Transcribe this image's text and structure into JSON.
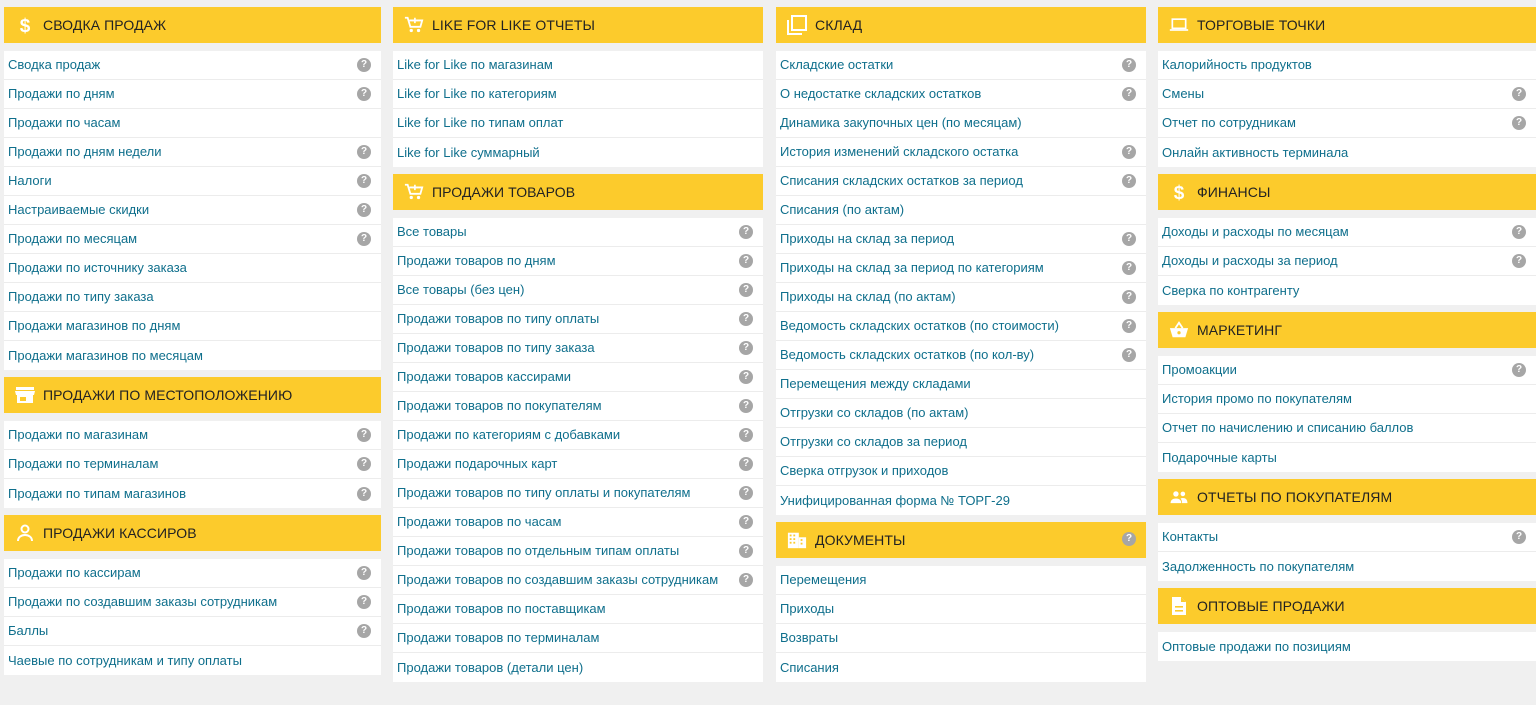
{
  "accent_color": "#fccb2c",
  "link_color": "#0f6f8c",
  "help_glyph": "?",
  "columns": [
    {
      "sections": [
        {
          "icon": "dollar-icon",
          "title": "СВОДКА ПРОДАЖ",
          "items": [
            {
              "label": "Сводка продаж",
              "help": true
            },
            {
              "label": "Продажи по дням",
              "help": true
            },
            {
              "label": "Продажи по часам",
              "help": false
            },
            {
              "label": "Продажи по дням недели",
              "help": true
            },
            {
              "label": "Налоги",
              "help": true
            },
            {
              "label": "Настраиваемые скидки",
              "help": true
            },
            {
              "label": "Продажи по месяцам",
              "help": true
            },
            {
              "label": "Продажи по источнику заказа",
              "help": false
            },
            {
              "label": "Продажи по типу заказа",
              "help": false
            },
            {
              "label": "Продажи магазинов по дням",
              "help": false
            },
            {
              "label": "Продажи магазинов по месяцам",
              "help": false
            }
          ]
        },
        {
          "icon": "store-icon",
          "title": "ПРОДАЖИ ПО МЕСТОПОЛОЖЕНИЮ",
          "items": [
            {
              "label": "Продажи по магазинам",
              "help": true
            },
            {
              "label": "Продажи по терминалам",
              "help": true
            },
            {
              "label": "Продажи по типам магазинов",
              "help": true
            }
          ]
        },
        {
          "icon": "person-icon",
          "title": "ПРОДАЖИ КАССИРОВ",
          "items": [
            {
              "label": "Продажи по кассирам",
              "help": true
            },
            {
              "label": "Продажи по создавшим заказы сотрудникам",
              "help": true
            },
            {
              "label": "Баллы",
              "help": true
            },
            {
              "label": "Чаевые по сотрудникам и типу оплаты",
              "help": false
            }
          ]
        }
      ]
    },
    {
      "sections": [
        {
          "icon": "cart-icon",
          "title": "LIKE FOR LIKE ОТЧЕТЫ",
          "items": [
            {
              "label": "Like for Like по магазинам",
              "help": false
            },
            {
              "label": "Like for Like по категориям",
              "help": false
            },
            {
              "label": "Like for Like по типам оплат",
              "help": false
            },
            {
              "label": "Like for Like суммарный",
              "help": false
            }
          ]
        },
        {
          "icon": "cart-icon",
          "title": "ПРОДАЖИ ТОВАРОВ",
          "items": [
            {
              "label": "Все товары",
              "help": true
            },
            {
              "label": "Продажи товаров по дням",
              "help": true
            },
            {
              "label": "Все товары (без цен)",
              "help": true
            },
            {
              "label": "Продажи товаров по типу оплаты",
              "help": true
            },
            {
              "label": "Продажи товаров по типу заказа",
              "help": true
            },
            {
              "label": "Продажи товаров кассирами",
              "help": true
            },
            {
              "label": "Продажи товаров по покупателям",
              "help": true
            },
            {
              "label": "Продажи по категориям с добавками",
              "help": true
            },
            {
              "label": "Продажи подарочных карт",
              "help": true
            },
            {
              "label": "Продажи товаров по типу оплаты и покупателям",
              "help": true
            },
            {
              "label": "Продажи товаров по часам",
              "help": true
            },
            {
              "label": "Продажи товаров по отдельным типам оплаты",
              "help": true
            },
            {
              "label": "Продажи товаров по создавшим заказы сотрудникам",
              "help": true
            },
            {
              "label": "Продажи товаров по поставщикам",
              "help": false
            },
            {
              "label": "Продажи товаров по терминалам",
              "help": false
            },
            {
              "label": "Продажи товаров (детали цен)",
              "help": false
            }
          ]
        }
      ]
    },
    {
      "sections": [
        {
          "icon": "copy-icon",
          "title": "СКЛАД",
          "items": [
            {
              "label": "Складские остатки",
              "help": true
            },
            {
              "label": "О недостатке складских остатков",
              "help": true
            },
            {
              "label": "Динамика закупочных цен (по месяцам)",
              "help": false
            },
            {
              "label": "История изменений складского остатка",
              "help": true
            },
            {
              "label": "Списания складских остатков за период",
              "help": true
            },
            {
              "label": "Списания (по актам)",
              "help": false
            },
            {
              "label": "Приходы на склад за период",
              "help": true
            },
            {
              "label": "Приходы на склад за период по категориям",
              "help": true
            },
            {
              "label": "Приходы на склад (по актам)",
              "help": true
            },
            {
              "label": "Ведомость складских остатков (по стоимости)",
              "help": true
            },
            {
              "label": "Ведомость складских остатков (по кол-ву)",
              "help": true
            },
            {
              "label": "Перемещения между складами",
              "help": false
            },
            {
              "label": "Отгрузки со складов (по актам)",
              "help": false
            },
            {
              "label": "Отгрузки со складов за период",
              "help": false
            },
            {
              "label": "Сверка отгрузок и приходов",
              "help": false
            },
            {
              "label": "Унифицированная форма № ТОРГ-29",
              "help": false
            }
          ]
        },
        {
          "icon": "building-icon",
          "title": "ДОКУМЕНТЫ",
          "header_help": true,
          "items": [
            {
              "label": "Перемещения",
              "help": false
            },
            {
              "label": "Приходы",
              "help": false
            },
            {
              "label": "Возвраты",
              "help": false
            },
            {
              "label": "Списания",
              "help": false
            }
          ]
        }
      ]
    },
    {
      "sections": [
        {
          "icon": "laptop-icon",
          "title": "ТОРГОВЫЕ ТОЧКИ",
          "items": [
            {
              "label": "Калорийность продуктов",
              "help": false
            },
            {
              "label": "Смены",
              "help": true
            },
            {
              "label": "Отчет по сотрудникам",
              "help": true
            },
            {
              "label": "Онлайн активность терминала",
              "help": false
            }
          ]
        },
        {
          "icon": "dollar-icon",
          "title": "ФИНАНСЫ",
          "items": [
            {
              "label": "Доходы и расходы по месяцам",
              "help": true
            },
            {
              "label": "Доходы и расходы за период",
              "help": true
            },
            {
              "label": "Сверка по контрагенту",
              "help": false
            }
          ]
        },
        {
          "icon": "basket-icon",
          "title": "МАРКЕТИНГ",
          "items": [
            {
              "label": "Промоакции",
              "help": true
            },
            {
              "label": "История промо по покупателям",
              "help": false
            },
            {
              "label": "Отчет по начислению и списанию баллов",
              "help": false
            },
            {
              "label": "Подарочные карты",
              "help": false
            }
          ]
        },
        {
          "icon": "people-icon",
          "title": "ОТЧЕТЫ ПО ПОКУПАТЕЛЯМ",
          "items": [
            {
              "label": "Контакты",
              "help": true
            },
            {
              "label": "Задолженность по покупателям",
              "help": false
            }
          ]
        },
        {
          "icon": "document-icon",
          "title": "ОПТОВЫЕ ПРОДАЖИ",
          "items": [
            {
              "label": "Оптовые продажи по позициям",
              "help": false
            }
          ]
        }
      ]
    }
  ]
}
